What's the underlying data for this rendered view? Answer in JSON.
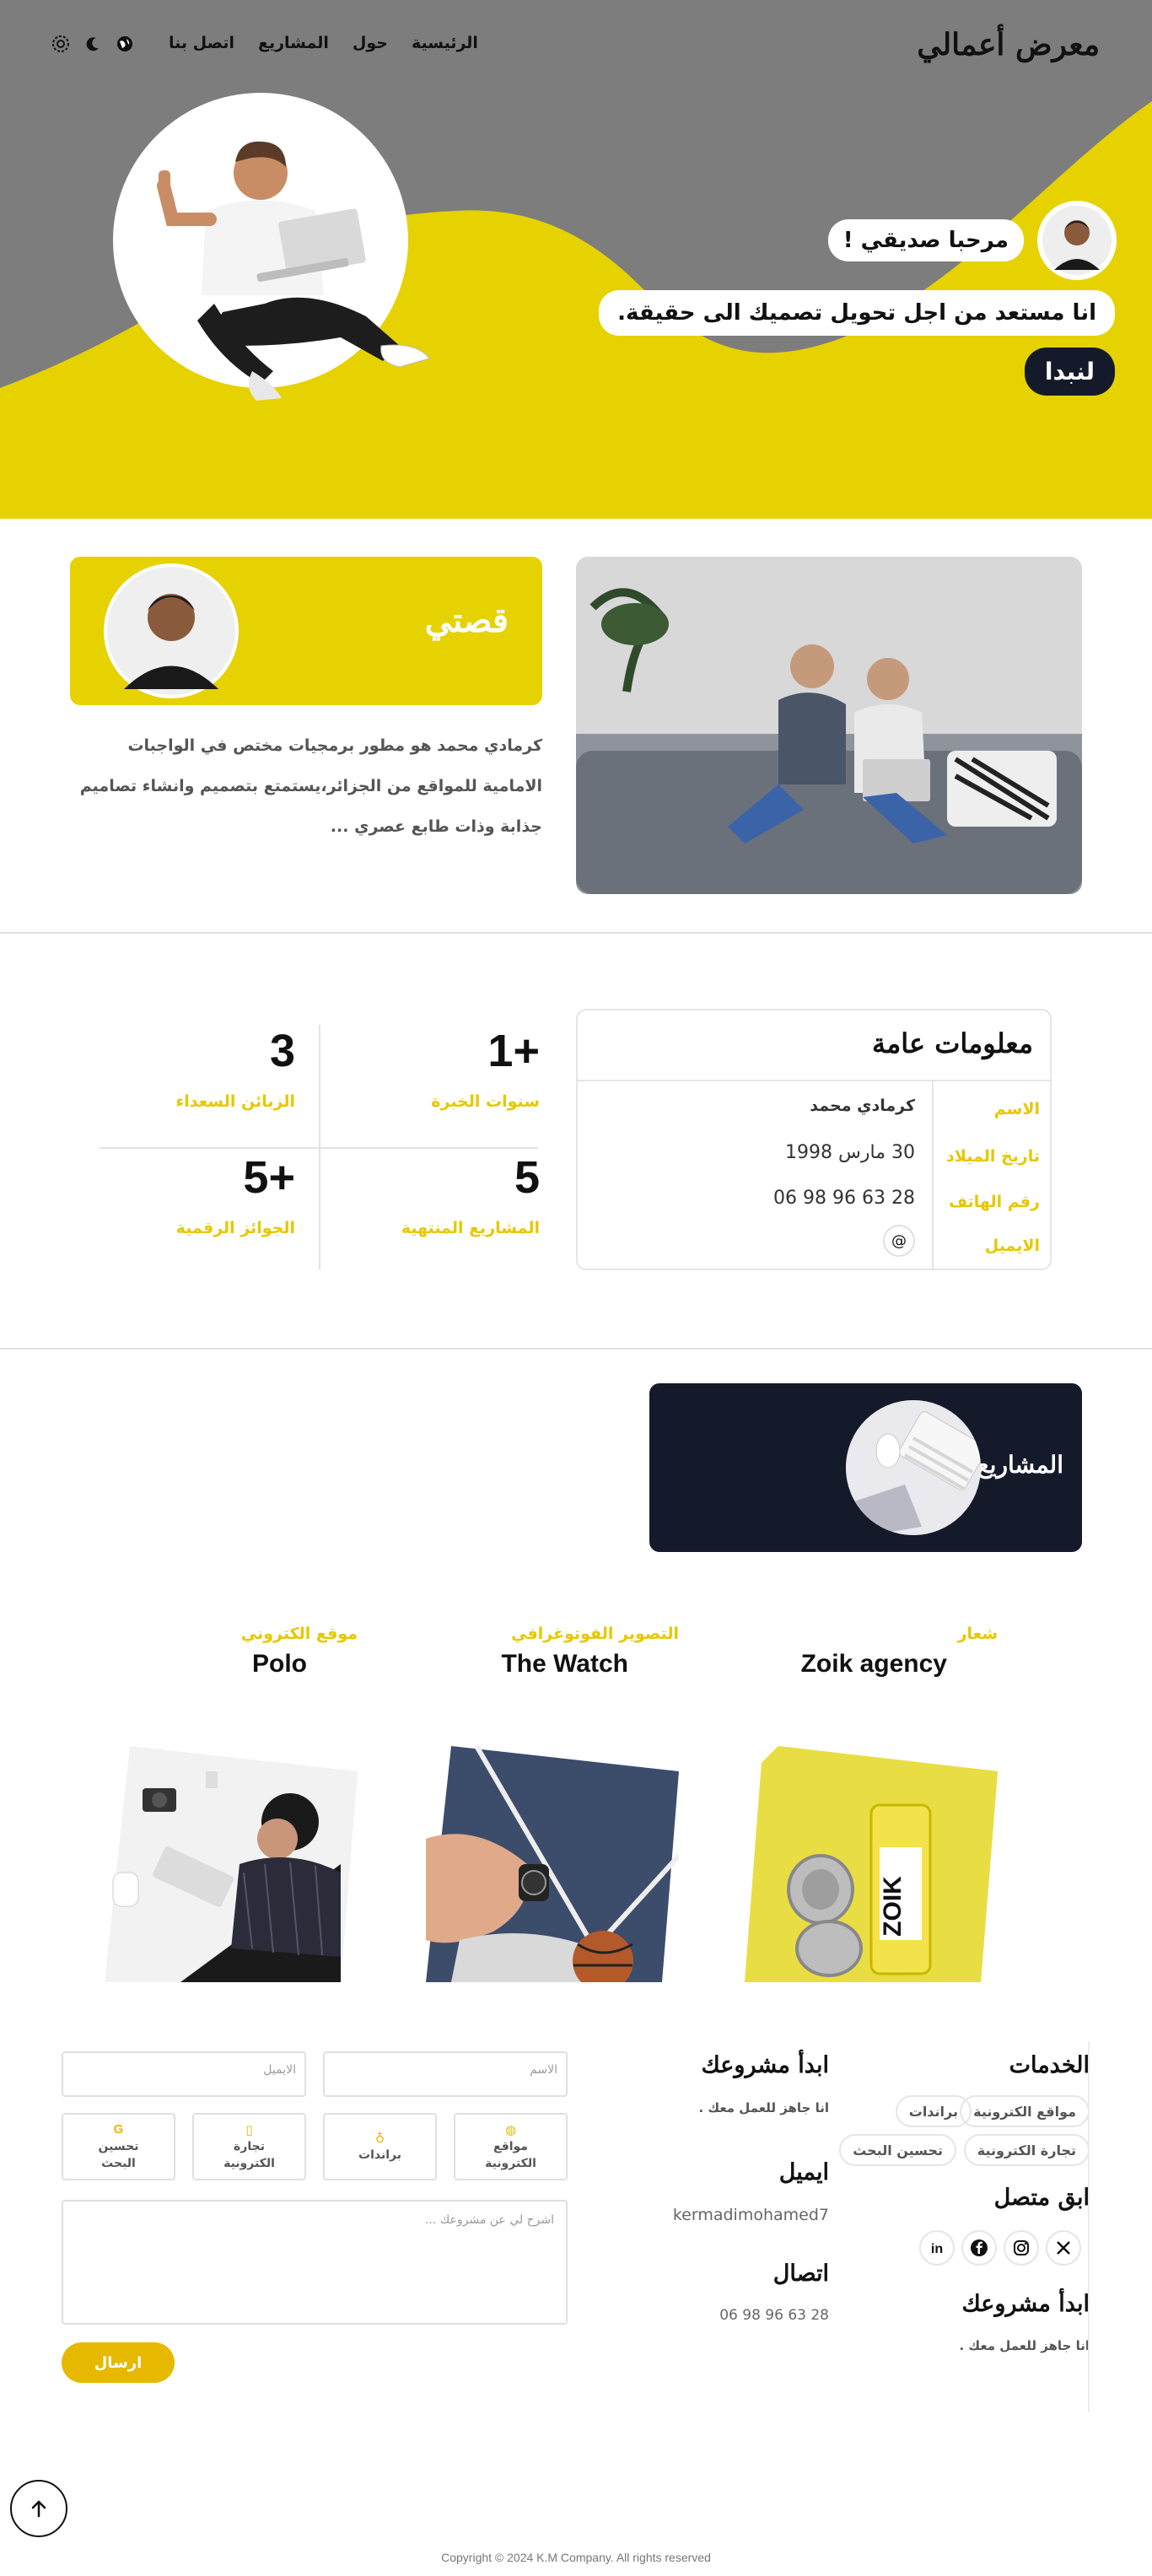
{
  "header": {
    "brand": "معرض أعمالي",
    "nav": [
      "الرئيسية",
      "حول",
      "المشاريع",
      "اتصل بنا"
    ],
    "icons": [
      "globe-icon",
      "moon-icon",
      "settings-icon"
    ]
  },
  "hero": {
    "greeting": "مرحبا صديقي !",
    "tagline": "انا مستعد من اجل تحويل تصميك الى حقيقة.",
    "cta": "لنبدا"
  },
  "story": {
    "title": "قصتي",
    "text": "كرمادي محمد هو مطور برمجيات مختص في الواجبات الامامية للمواقع من الجزائر،يستمتع بتصميم وانشاء تصاميم جذابة وذات طابع عصري ..."
  },
  "stats": [
    {
      "value": "+1",
      "label": "سنوات الخبرة"
    },
    {
      "value": "3",
      "label": "الزبائن السعداء"
    },
    {
      "value": "5",
      "label": "المشاريع المنتهية"
    },
    {
      "value": "+5",
      "label": "الجوائز الرقمية"
    }
  ],
  "info": {
    "title": "معلومات عامة",
    "rows": [
      {
        "key": "الاسم",
        "value": "كرمادي محمد"
      },
      {
        "key": "تاريخ الميلاد",
        "value": "30 مارس 1998"
      },
      {
        "key": "رقم الهاتف",
        "value": "06 98 96 63 28"
      },
      {
        "key": "الايميل",
        "value": "@"
      }
    ]
  },
  "projects": {
    "title": "المشاريع",
    "items": [
      {
        "category": "شعار",
        "name": "Zoik agency"
      },
      {
        "category": "التصوير الفوتوغرافي",
        "name": "The Watch"
      },
      {
        "category": "موقع الكتروني",
        "name": "Polo"
      }
    ]
  },
  "footer": {
    "services_title": "الخدمات",
    "services": [
      "مواقع الكترونية",
      "براندات",
      "تجارة الكترونية",
      "تحسين البحث"
    ],
    "keep_in_touch": "ابق متصل",
    "socials": [
      "x-icon",
      "instagram-icon",
      "facebook-icon",
      "linkedin-icon"
    ],
    "start_title": "ابدأ مشروعك",
    "start_sub": "انا جاهز للعمل معك .",
    "start_title_2": "ابدأ مشروعك",
    "start_sub_2": "انا جاهز للعمل معك .",
    "email_title": "ايميل",
    "email_value": "kermadimohamed7",
    "phone_title": "اتصال",
    "phone_value": "06 98 96 63 28",
    "form": {
      "name_placeholder": "الاسم",
      "email_placeholder": "الايميل",
      "options": [
        {
          "icon": "globe-icon",
          "label": "مواقع الكترونية"
        },
        {
          "icon": "bulb-icon",
          "label": "براندات"
        },
        {
          "icon": "phone-icon",
          "label": "تجارة الكترونية"
        },
        {
          "icon": "google-icon",
          "label": "تحسين البحث"
        }
      ],
      "message_placeholder": "اشرح لي عن مشروعك ...",
      "send": "ارسال"
    },
    "copyright": "Copyright © 2024 K.M Company. All rights reserved"
  },
  "colors": {
    "accent": "#e6d200",
    "dark": "#151a2b",
    "grey": "#7d7d7d"
  }
}
